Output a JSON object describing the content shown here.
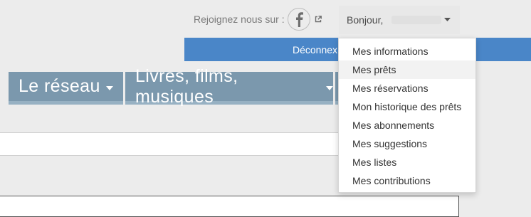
{
  "header": {
    "social_label": "Rejoignez nous sur :",
    "facebook_icon": "facebook-icon",
    "external_icon": "external-link-icon"
  },
  "user_menu": {
    "greeting": "Bonjour,",
    "caret_icon": "caret-down-icon"
  },
  "logout_label": "Déconnex",
  "nav": {
    "items": [
      {
        "label": "Le réseau"
      },
      {
        "label": "Livres, films, musiques"
      }
    ]
  },
  "dropdown": {
    "items": [
      {
        "label": "Mes informations"
      },
      {
        "label": "Mes prêts"
      },
      {
        "label": "Mes réservations"
      },
      {
        "label": "Mon historique des prêts"
      },
      {
        "label": "Mes abonnements"
      },
      {
        "label": "Mes suggestions"
      },
      {
        "label": "Mes listes"
      },
      {
        "label": "Mes contributions"
      }
    ]
  },
  "colors": {
    "background": "#ececec",
    "nav_bg": "#7b98ad",
    "nav_border": "#97b1c3",
    "logout_bg": "#4a86c8"
  }
}
